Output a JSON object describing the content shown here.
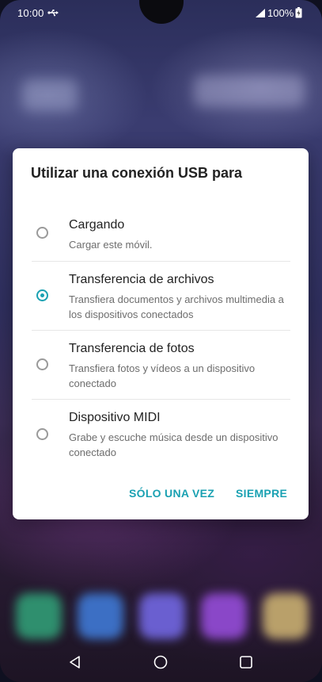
{
  "status_bar": {
    "time": "10:00",
    "battery_percent": "100%",
    "icons": [
      "usb-icon",
      "signal-icon",
      "battery-icon"
    ]
  },
  "dialog": {
    "title": "Utilizar una conexión USB para",
    "options": [
      {
        "title": "Cargando",
        "subtitle": "Cargar este móvil.",
        "selected": false
      },
      {
        "title": "Transferencia de archivos",
        "subtitle": "Transfiera documentos y archivos multimedia a los dispositivos conectados",
        "selected": true
      },
      {
        "title": "Transferencia de fotos",
        "subtitle": "Transfiera fotos y vídeos a un dispositivo conectado",
        "selected": false
      },
      {
        "title": "Dispositivo MIDI",
        "subtitle": "Grabe y escuche música desde un dispositivo conectado",
        "selected": false
      }
    ],
    "actions": {
      "once_label": "SÓLO UNA VEZ",
      "always_label": "SIEMPRE"
    }
  },
  "colors": {
    "accent": "#1aa1b2",
    "radio_unselected": "#9a9a9a",
    "title_text": "#222222",
    "subtitle_text": "#6d6d6d"
  },
  "navigation_bar": {
    "icons": [
      "back-icon",
      "home-icon",
      "recent-apps-icon"
    ]
  }
}
